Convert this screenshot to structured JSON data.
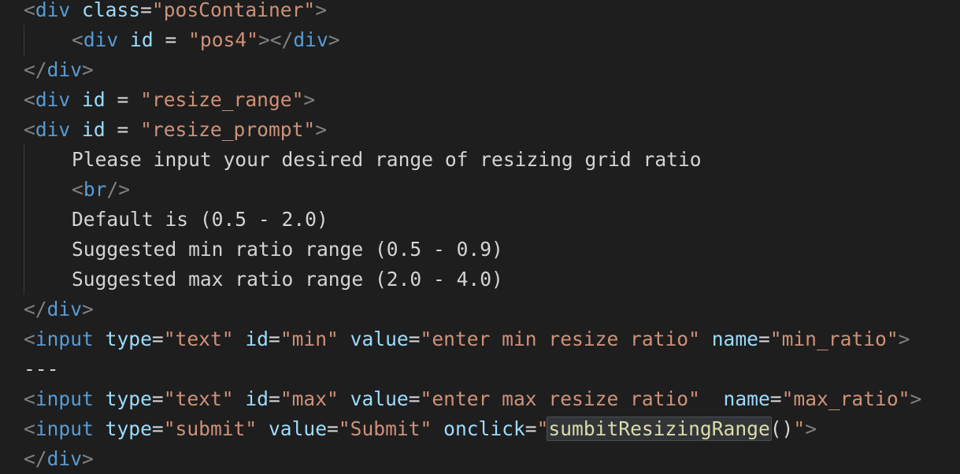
{
  "editor": {
    "lines": [
      {
        "indent": 0,
        "tokens": [
          {
            "t": "punc",
            "v": "<"
          },
          {
            "t": "tag",
            "v": "div"
          },
          {
            "t": "sp",
            "v": " "
          },
          {
            "t": "attr",
            "v": "class"
          },
          {
            "t": "op",
            "v": "="
          },
          {
            "t": "str",
            "v": "\"posContainer\""
          },
          {
            "t": "punc",
            "v": ">"
          }
        ]
      },
      {
        "indent": 1,
        "tokens": [
          {
            "t": "punc",
            "v": "<"
          },
          {
            "t": "tag",
            "v": "div"
          },
          {
            "t": "sp",
            "v": " "
          },
          {
            "t": "attr",
            "v": "id"
          },
          {
            "t": "op",
            "v": " = "
          },
          {
            "t": "str",
            "v": "\"pos4\""
          },
          {
            "t": "punc",
            "v": "></"
          },
          {
            "t": "tag",
            "v": "div"
          },
          {
            "t": "punc",
            "v": ">"
          }
        ]
      },
      {
        "indent": 0,
        "tokens": [
          {
            "t": "punc",
            "v": "</"
          },
          {
            "t": "tag",
            "v": "div"
          },
          {
            "t": "punc",
            "v": ">"
          }
        ]
      },
      {
        "indent": 0,
        "tokens": [
          {
            "t": "punc",
            "v": "<"
          },
          {
            "t": "tag",
            "v": "div"
          },
          {
            "t": "sp",
            "v": " "
          },
          {
            "t": "attr",
            "v": "id"
          },
          {
            "t": "op",
            "v": " = "
          },
          {
            "t": "str",
            "v": "\"resize_range\""
          },
          {
            "t": "punc",
            "v": ">"
          }
        ]
      },
      {
        "indent": 0,
        "tokens": [
          {
            "t": "punc",
            "v": "<"
          },
          {
            "t": "tag",
            "v": "div"
          },
          {
            "t": "sp",
            "v": " "
          },
          {
            "t": "attr",
            "v": "id"
          },
          {
            "t": "op",
            "v": " = "
          },
          {
            "t": "str",
            "v": "\"resize_prompt\""
          },
          {
            "t": "punc",
            "v": ">"
          }
        ]
      },
      {
        "indent": 1,
        "tokens": [
          {
            "t": "text",
            "v": "Please input your desired range of resizing grid ratio"
          }
        ]
      },
      {
        "indent": 1,
        "tokens": [
          {
            "t": "punc",
            "v": "<"
          },
          {
            "t": "tag",
            "v": "br"
          },
          {
            "t": "punc",
            "v": "/>"
          }
        ]
      },
      {
        "indent": 1,
        "tokens": [
          {
            "t": "text",
            "v": "Default is (0.5 - 2.0)"
          }
        ]
      },
      {
        "indent": 1,
        "tokens": [
          {
            "t": "text",
            "v": "Suggested min ratio range (0.5 - 0.9)"
          }
        ]
      },
      {
        "indent": 1,
        "tokens": [
          {
            "t": "text",
            "v": "Suggested max ratio range (2.0 - 4.0)"
          }
        ]
      },
      {
        "indent": 0,
        "tokens": [
          {
            "t": "punc",
            "v": "</"
          },
          {
            "t": "tag",
            "v": "div"
          },
          {
            "t": "punc",
            "v": ">"
          }
        ]
      },
      {
        "indent": 0,
        "tokens": [
          {
            "t": "punc",
            "v": "<"
          },
          {
            "t": "tag",
            "v": "input"
          },
          {
            "t": "sp",
            "v": " "
          },
          {
            "t": "attr",
            "v": "type"
          },
          {
            "t": "op",
            "v": "="
          },
          {
            "t": "str",
            "v": "\"text\""
          },
          {
            "t": "sp",
            "v": " "
          },
          {
            "t": "attr",
            "v": "id"
          },
          {
            "t": "op",
            "v": "="
          },
          {
            "t": "str",
            "v": "\"min\""
          },
          {
            "t": "sp",
            "v": " "
          },
          {
            "t": "attr",
            "v": "value"
          },
          {
            "t": "op",
            "v": "="
          },
          {
            "t": "str",
            "v": "\"enter min resize ratio\""
          },
          {
            "t": "sp",
            "v": " "
          },
          {
            "t": "attr",
            "v": "name"
          },
          {
            "t": "op",
            "v": "="
          },
          {
            "t": "str",
            "v": "\"min_ratio\""
          },
          {
            "t": "punc",
            "v": ">"
          }
        ]
      },
      {
        "indent": 0,
        "tokens": [
          {
            "t": "text",
            "v": "---"
          }
        ]
      },
      {
        "indent": 0,
        "tokens": [
          {
            "t": "punc",
            "v": "<"
          },
          {
            "t": "tag",
            "v": "input"
          },
          {
            "t": "sp",
            "v": " "
          },
          {
            "t": "attr",
            "v": "type"
          },
          {
            "t": "op",
            "v": "="
          },
          {
            "t": "str",
            "v": "\"text\""
          },
          {
            "t": "sp",
            "v": " "
          },
          {
            "t": "attr",
            "v": "id"
          },
          {
            "t": "op",
            "v": "="
          },
          {
            "t": "str",
            "v": "\"max\""
          },
          {
            "t": "sp",
            "v": " "
          },
          {
            "t": "attr",
            "v": "value"
          },
          {
            "t": "op",
            "v": "="
          },
          {
            "t": "str",
            "v": "\"enter max resize ratio\""
          },
          {
            "t": "sp",
            "v": "  "
          },
          {
            "t": "attr",
            "v": "name"
          },
          {
            "t": "op",
            "v": "="
          },
          {
            "t": "str",
            "v": "\"max_ratio\""
          },
          {
            "t": "punc",
            "v": ">"
          }
        ]
      },
      {
        "indent": 0,
        "tokens": [
          {
            "t": "punc",
            "v": "<"
          },
          {
            "t": "tag",
            "v": "input"
          },
          {
            "t": "sp",
            "v": " "
          },
          {
            "t": "attr",
            "v": "type"
          },
          {
            "t": "op",
            "v": "="
          },
          {
            "t": "str",
            "v": "\"submit\""
          },
          {
            "t": "sp",
            "v": " "
          },
          {
            "t": "attr",
            "v": "value"
          },
          {
            "t": "op",
            "v": "="
          },
          {
            "t": "str",
            "v": "\"Submit\""
          },
          {
            "t": "sp",
            "v": " "
          },
          {
            "t": "attr",
            "v": "onclick"
          },
          {
            "t": "op",
            "v": "="
          },
          {
            "t": "str",
            "v": "\""
          },
          {
            "t": "fn",
            "v": "sumbitResizingRange",
            "highlight": true
          },
          {
            "t": "op",
            "v": "()"
          },
          {
            "t": "str",
            "v": "\""
          },
          {
            "t": "punc",
            "v": ">"
          }
        ]
      },
      {
        "indent": 0,
        "tokens": [
          {
            "t": "punc",
            "v": "</"
          },
          {
            "t": "tag",
            "v": "div"
          },
          {
            "t": "punc",
            "v": ">"
          }
        ]
      }
    ]
  },
  "colors": {
    "background": "#1e1e1e",
    "tag": "#569cd6",
    "attribute": "#9cdcfe",
    "string": "#ce9178",
    "text": "#d4d4d4",
    "punctuation": "#808080",
    "function": "#dcdcaa",
    "highlight": "#323538"
  }
}
